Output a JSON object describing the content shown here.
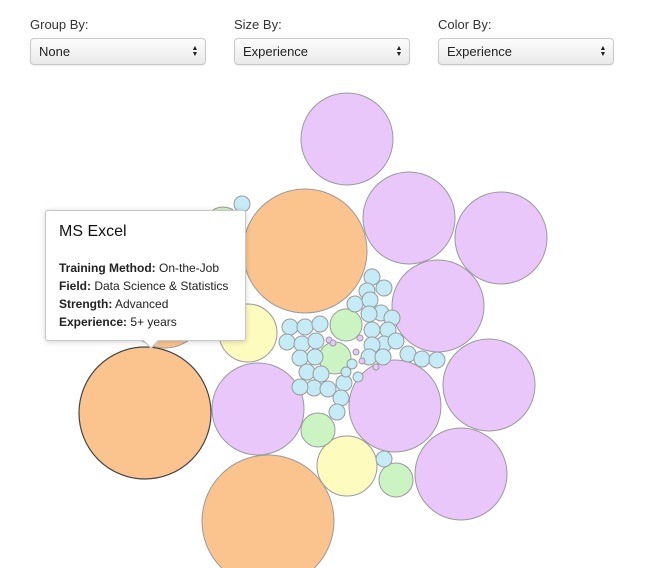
{
  "controls": [
    {
      "label": "Group By:",
      "value": "None"
    },
    {
      "label": "Size By:",
      "value": "Experience"
    },
    {
      "label": "Color By:",
      "value": "Experience"
    }
  ],
  "tooltip": {
    "title": "MS Excel",
    "rows": [
      {
        "key": "Training Method:",
        "value": "On-the-Job"
      },
      {
        "key": "Field:",
        "value": "Data Science & Statistics"
      },
      {
        "key": "Strength:",
        "value": "Advanced"
      },
      {
        "key": "Experience:",
        "value": "5+ years"
      }
    ]
  },
  "colors": {
    "orange": "#fbc48f",
    "purple": "#e9c7fb",
    "yellow": "#fdfbbd",
    "green": "#cbf4c2",
    "blue": "#c5ebf7",
    "stroke": "#9a9a9a",
    "highlight_stroke": "#444444"
  }
}
